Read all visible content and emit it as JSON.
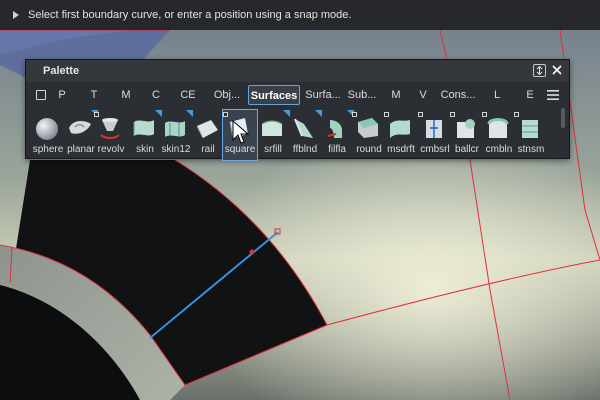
{
  "prompt": {
    "text": "Select first boundary curve, or enter a position using a snap mode."
  },
  "palette": {
    "title": "Palette",
    "tabs": [
      {
        "label": "P"
      },
      {
        "label": "T"
      },
      {
        "label": "M"
      },
      {
        "label": "C"
      },
      {
        "label": "CE"
      },
      {
        "label": "Obj..."
      },
      {
        "label": "Surfaces",
        "active": true
      },
      {
        "label": "Surfa..."
      },
      {
        "label": "Sub..."
      },
      {
        "label": "M"
      },
      {
        "label": "V"
      },
      {
        "label": "Cons..."
      },
      {
        "label": "L"
      },
      {
        "label": "E"
      }
    ],
    "tools": [
      {
        "label": "sphere",
        "icon": "sphere-icon"
      },
      {
        "label": "planar",
        "icon": "planar-icon"
      },
      {
        "label": "revolv",
        "icon": "revolve-icon"
      },
      {
        "label": "skin",
        "icon": "skin-icon"
      },
      {
        "label": "skin12",
        "icon": "skin12-icon"
      },
      {
        "label": "rail",
        "icon": "rail-icon"
      },
      {
        "label": "square",
        "icon": "square-icon",
        "selected": true
      },
      {
        "label": "srfill",
        "icon": "srfill-icon"
      },
      {
        "label": "ffblnd",
        "icon": "ffblnd-icon"
      },
      {
        "label": "filfla",
        "icon": "filfla-icon"
      },
      {
        "label": "round",
        "icon": "round-icon"
      },
      {
        "label": "msdrft",
        "icon": "msdrft-icon"
      },
      {
        "label": "cmbsrl",
        "icon": "cmbsrl-icon"
      },
      {
        "label": "ballcr",
        "icon": "ballcr-icon"
      },
      {
        "label": "cmbln",
        "icon": "cmbln-icon"
      },
      {
        "label": "stnsm",
        "icon": "stnsm-icon"
      }
    ]
  },
  "colors": {
    "accent": "#3aa2e0",
    "curve": "#e0303a",
    "selected_curve": "#3a8fe0",
    "panel": "#2b2e33"
  }
}
